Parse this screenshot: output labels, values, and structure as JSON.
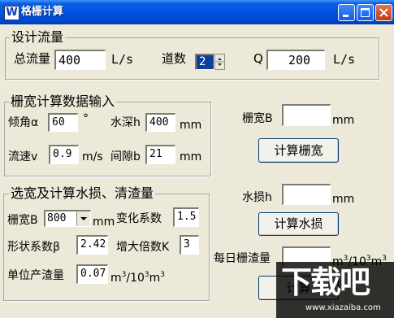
{
  "window": {
    "app_icon": "W",
    "title": "格栅计算"
  },
  "design_flow": {
    "legend": "设计流量",
    "total_flow_label": "总流量",
    "total_flow_value": "400",
    "total_flow_unit": "L/s",
    "channels_label": "道数",
    "channels_value": "2",
    "q_label": "Q",
    "q_value": "200",
    "q_unit": "L/s"
  },
  "width_input": {
    "legend": "栅宽计算数据输入",
    "angle_label": "倾角α",
    "angle_value": "60",
    "angle_unit": "°",
    "depth_label": "水深h",
    "depth_value": "400",
    "depth_unit": "mm",
    "velocity_label": "流速v",
    "velocity_value": "0.9",
    "velocity_unit": "m/s",
    "gap_label": "间隙b",
    "gap_value": "21",
    "gap_unit": "mm"
  },
  "width_result": {
    "label": "栅宽B",
    "value": "",
    "unit": "mm",
    "button": "计算栅宽"
  },
  "loss_section": {
    "legend": "选宽及计算水损、清渣量",
    "width_label": "栅宽B",
    "width_selected": "800",
    "width_unit": "mm",
    "change_coef_label": "变化系数",
    "change_coef_value": "1.5",
    "shape_coef_label": "形状系数β",
    "shape_coef_value": "2.42",
    "multiplier_label": "增大倍数K",
    "multiplier_value": "3",
    "unit_slag_label": "单位产渣量",
    "unit_slag_value": "0.07",
    "unit_slag_unit_a": "m",
    "unit_slag_unit_sup": "3",
    "unit_slag_unit_b": "/10",
    "unit_slag_unit_sup2": "3",
    "unit_slag_unit_c": "m",
    "unit_slag_unit_sup3": "3"
  },
  "loss_result": {
    "label": "水损h",
    "value": "",
    "unit": "mm",
    "button": "计算水损"
  },
  "slag_result": {
    "label": "每日栅渣量",
    "value": "",
    "unit_a": "m",
    "unit_sup": "3",
    "unit_b": "/10",
    "unit_sup2": "3",
    "unit_c": "m",
    "unit_sup3": "3",
    "button_partial": "计算"
  },
  "watermark": {
    "text": "下载吧",
    "url": "www.xiazaiba.com"
  }
}
